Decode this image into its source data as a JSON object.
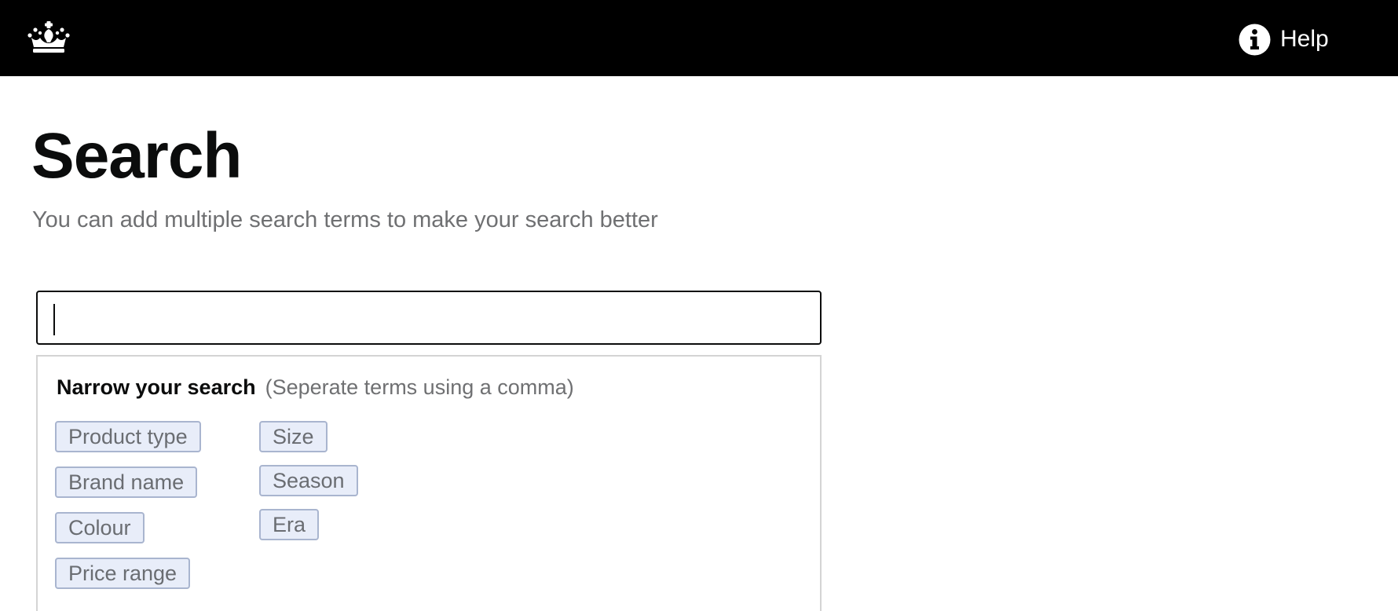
{
  "header": {
    "logo_icon": "crown-icon",
    "help": {
      "icon": "info-icon",
      "label": "Help"
    }
  },
  "main": {
    "title": "Search",
    "hint": "You can add multiple search terms to make your search better",
    "search": {
      "value": "",
      "placeholder": ""
    }
  },
  "narrow": {
    "title": "Narrow your search",
    "note": "(Seperate terms using a comma)",
    "column1": [
      "Product type",
      "Brand name",
      "Colour",
      "Price range"
    ],
    "column2": [
      "Size",
      "Season",
      "Era"
    ]
  },
  "colors": {
    "header_bg": "#000000",
    "tag_bg": "#e8edf9",
    "tag_border": "#a9b5cf",
    "muted_text": "#6f7072"
  }
}
